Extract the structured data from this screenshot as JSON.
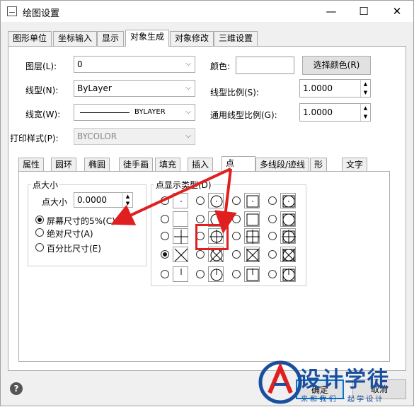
{
  "window": {
    "title": "绘图设置",
    "min": "—",
    "max": "☐",
    "close": "✕"
  },
  "tabs": [
    "图形单位",
    "坐标输入",
    "显示",
    "对象生成",
    "对象修改",
    "三维设置"
  ],
  "form": {
    "layer_label": "图层(L):",
    "layer_value": "0",
    "linetype_label": "线型(N):",
    "linetype_value": "ByLayer",
    "lineweight_label": "线宽(W):",
    "lineweight_value": "BYLAYER",
    "plotstyle_label": "打印样式(P):",
    "plotstyle_value": "BYCOLOR",
    "color_label": "颜色:",
    "select_color_button": "选择颜色(R)",
    "ltscale_label": "线型比例(S):",
    "ltscale_value": "1.0000",
    "global_ltscale_label": "通用线型比例(G):",
    "global_ltscale_value": "1.0000"
  },
  "subtabs": [
    "属性",
    "圆环",
    "椭圆",
    "徒手画",
    "填充",
    "插入",
    "点",
    "多线段/迹线",
    "形",
    "文字"
  ],
  "point_size": {
    "group_title": "点大小",
    "size_label": "点大小",
    "size_value": "0.0000",
    "option_screen": "屏幕尺寸的5%(C)",
    "option_absolute": "绝对尺寸(A)",
    "option_percent": "百分比尺寸(E)",
    "selected": "option_screen"
  },
  "point_type": {
    "group_title": "点显示类型(D)",
    "selected_index": 12
  },
  "buttons": {
    "ok": "确定",
    "cancel": "取消",
    "help": "?"
  },
  "watermark": {
    "brand": "设计学徒",
    "slogan": "来 和 我 们 一 起 学 设 计"
  },
  "colors": {
    "annotation": "#e02020",
    "watermark_blue": "#1a4fa0"
  }
}
